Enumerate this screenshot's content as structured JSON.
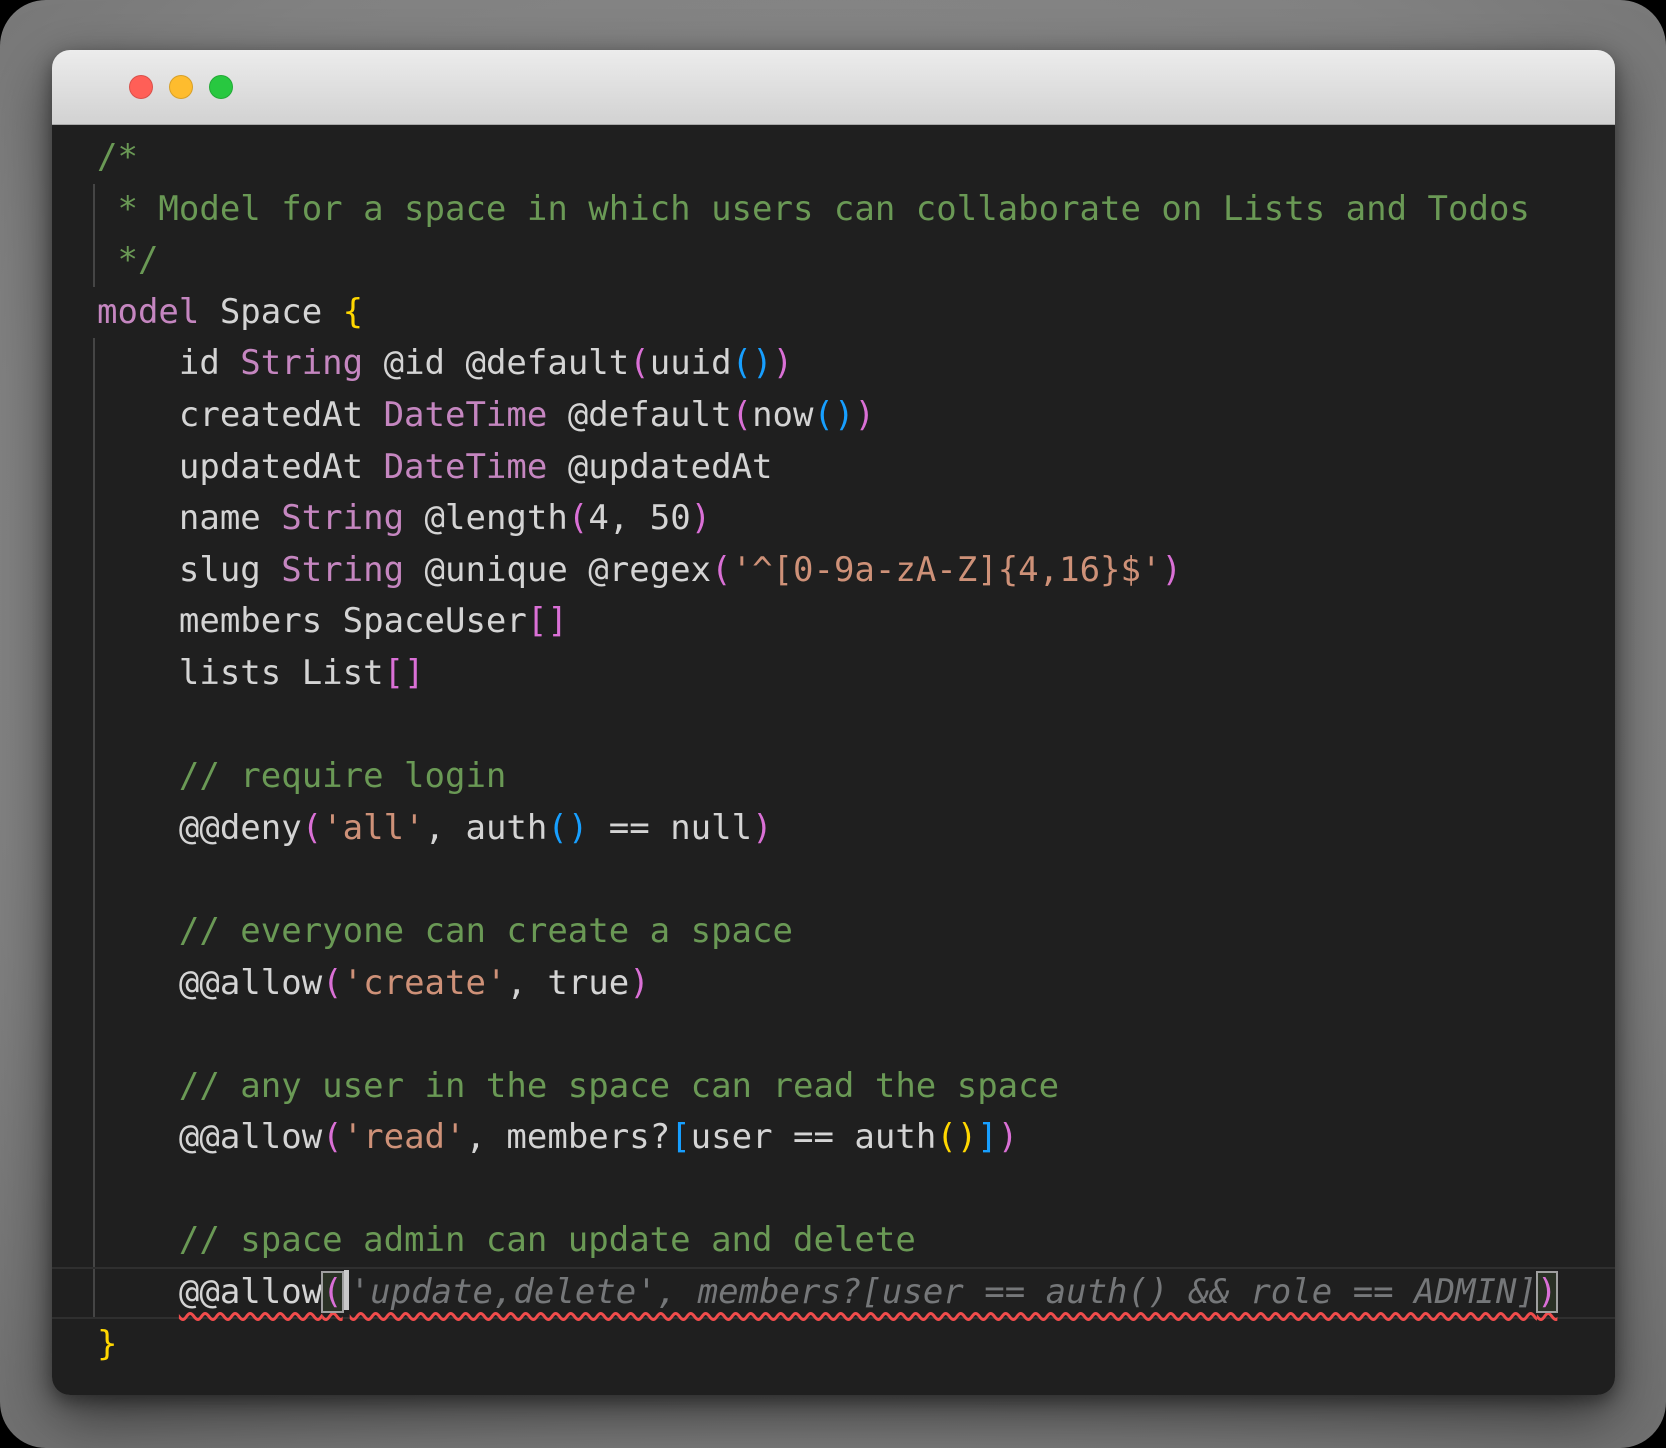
{
  "colors": {
    "bg": "#1f1f1f",
    "fg": "#d4d4d4",
    "comment": "#6A9955",
    "keyword": "#C586C0",
    "string": "#CE9178",
    "bracket1": "#FFD700",
    "bracket2": "#DA70D6",
    "bracket3": "#179FFF",
    "ghost": "#757779",
    "error": "#F14C4C",
    "guide": "#454545",
    "cursor": "#c9c9c9",
    "titlebar_top": "#ececec",
    "titlebar_bottom": "#d2d2d2",
    "tl_red": "#ff5f57",
    "tl_yellow": "#febc2e",
    "tl_green": "#28c840"
  },
  "window": {
    "traffic_lights": [
      "close",
      "minimize",
      "zoom"
    ]
  },
  "code": {
    "lines": [
      {
        "seg": [
          {
            "t": "/*",
            "c": "com"
          }
        ]
      },
      {
        "seg": [
          {
            "t": " * Model for a space in which users can collaborate on Lists and Todos",
            "c": "com"
          }
        ]
      },
      {
        "seg": [
          {
            "t": " */",
            "c": "com"
          }
        ]
      },
      {
        "seg": [
          {
            "t": "model",
            "c": "kw"
          },
          {
            "t": " Space ",
            "c": "fg"
          },
          {
            "t": "{",
            "c": "b1"
          }
        ]
      },
      {
        "seg": [
          {
            "t": "    id ",
            "c": "fg"
          },
          {
            "t": "String",
            "c": "kw"
          },
          {
            "t": " @id @default",
            "c": "fg"
          },
          {
            "t": "(",
            "c": "b2"
          },
          {
            "t": "uuid",
            "c": "fg"
          },
          {
            "t": "()",
            "c": "b3"
          },
          {
            "t": ")",
            "c": "b2"
          }
        ]
      },
      {
        "seg": [
          {
            "t": "    createdAt ",
            "c": "fg"
          },
          {
            "t": "DateTime",
            "c": "kw"
          },
          {
            "t": " @default",
            "c": "fg"
          },
          {
            "t": "(",
            "c": "b2"
          },
          {
            "t": "now",
            "c": "fg"
          },
          {
            "t": "()",
            "c": "b3"
          },
          {
            "t": ")",
            "c": "b2"
          }
        ]
      },
      {
        "seg": [
          {
            "t": "    updatedAt ",
            "c": "fg"
          },
          {
            "t": "DateTime",
            "c": "kw"
          },
          {
            "t": " @updatedAt",
            "c": "fg"
          }
        ]
      },
      {
        "seg": [
          {
            "t": "    name ",
            "c": "fg"
          },
          {
            "t": "String",
            "c": "kw"
          },
          {
            "t": " @length",
            "c": "fg"
          },
          {
            "t": "(",
            "c": "b2"
          },
          {
            "t": "4, 50",
            "c": "fg"
          },
          {
            "t": ")",
            "c": "b2"
          }
        ]
      },
      {
        "seg": [
          {
            "t": "    slug ",
            "c": "fg"
          },
          {
            "t": "String",
            "c": "kw"
          },
          {
            "t": " @unique @regex",
            "c": "fg"
          },
          {
            "t": "(",
            "c": "b2"
          },
          {
            "t": "'^[0-9a-zA-Z]{4,16}$'",
            "c": "str"
          },
          {
            "t": ")",
            "c": "b2"
          }
        ]
      },
      {
        "seg": [
          {
            "t": "    members SpaceUser",
            "c": "fg"
          },
          {
            "t": "[]",
            "c": "b2"
          }
        ]
      },
      {
        "seg": [
          {
            "t": "    lists List",
            "c": "fg"
          },
          {
            "t": "[]",
            "c": "b2"
          }
        ]
      },
      {
        "seg": []
      },
      {
        "seg": [
          {
            "t": "    // require login",
            "c": "com"
          }
        ]
      },
      {
        "seg": [
          {
            "t": "    @@deny",
            "c": "fg"
          },
          {
            "t": "(",
            "c": "b2"
          },
          {
            "t": "'all'",
            "c": "str"
          },
          {
            "t": ", auth",
            "c": "fg"
          },
          {
            "t": "()",
            "c": "b3"
          },
          {
            "t": " == null",
            "c": "fg"
          },
          {
            "t": ")",
            "c": "b2"
          }
        ]
      },
      {
        "seg": []
      },
      {
        "seg": [
          {
            "t": "    // everyone can create a space",
            "c": "com"
          }
        ]
      },
      {
        "seg": [
          {
            "t": "    @@allow",
            "c": "fg"
          },
          {
            "t": "(",
            "c": "b2"
          },
          {
            "t": "'create'",
            "c": "str"
          },
          {
            "t": ", true",
            "c": "fg"
          },
          {
            "t": ")",
            "c": "b2"
          }
        ]
      },
      {
        "seg": []
      },
      {
        "seg": [
          {
            "t": "    // any user in the space can read the space",
            "c": "com"
          }
        ]
      },
      {
        "seg": [
          {
            "t": "    @@allow",
            "c": "fg"
          },
          {
            "t": "(",
            "c": "b2"
          },
          {
            "t": "'read'",
            "c": "str"
          },
          {
            "t": ", members?",
            "c": "fg"
          },
          {
            "t": "[",
            "c": "b3"
          },
          {
            "t": "user == auth",
            "c": "fg"
          },
          {
            "t": "()",
            "c": "b1"
          },
          {
            "t": "]",
            "c": "b3"
          },
          {
            "t": ")",
            "c": "b2"
          }
        ]
      },
      {
        "seg": []
      },
      {
        "seg": [
          {
            "t": "    // space admin can update and delete",
            "c": "com"
          }
        ]
      },
      {
        "active": true,
        "squiggle_from": 1,
        "seg": [
          {
            "t": "    ",
            "c": "fg"
          },
          {
            "t": "@@allow",
            "c": "fg"
          },
          {
            "t": "(",
            "c": "b2",
            "box": true,
            "name": "matched-open-paren"
          },
          {
            "cursor": true
          },
          {
            "t": "'update,delete', members?[user == auth() && role == ADMIN]",
            "c": "ghost",
            "name": "inline-suggestion-ghost-text"
          },
          {
            "t": ")",
            "c": "b2",
            "box": true,
            "name": "matched-close-paren"
          }
        ]
      },
      {
        "seg": [
          {
            "t": "}",
            "c": "b1"
          }
        ]
      }
    ]
  }
}
